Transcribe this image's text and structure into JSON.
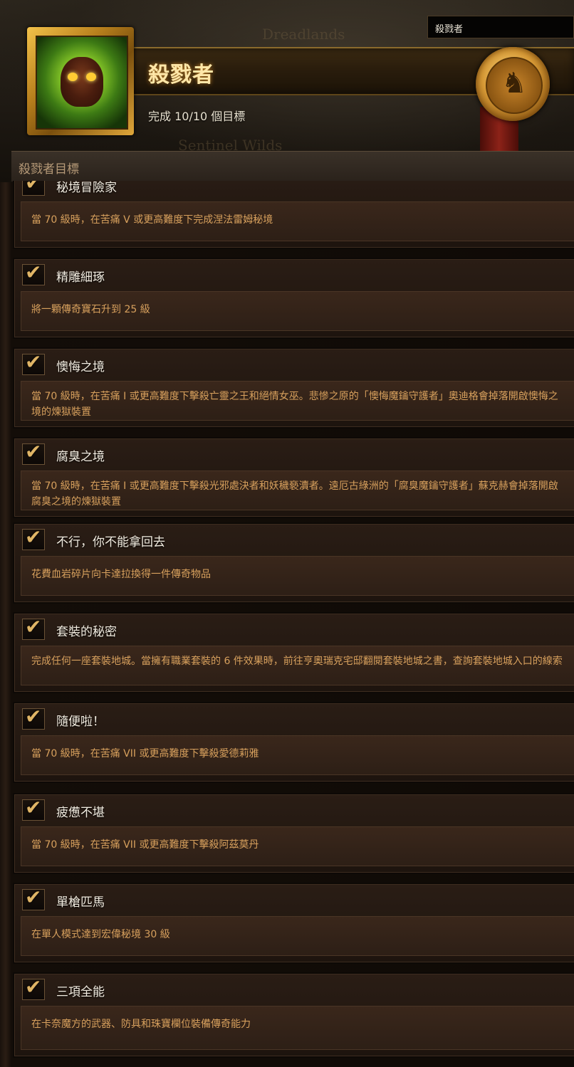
{
  "header": {
    "title": "殺戮者",
    "progress_text": "完成 10/10 個目標",
    "search_value": "殺戮者",
    "section_label": "殺戮者目標",
    "map_labels": [
      "Dreadlands",
      "Sentinel Wilds"
    ]
  },
  "icons": {
    "achievement": "skull-achievement-icon",
    "medal": "wolf-crest-medal-icon",
    "check": "checkmark-icon"
  },
  "colors": {
    "title_glow": "#c8872a",
    "description_text": "#d7a05d",
    "item_title_text": "#f2ece0"
  },
  "objectives": [
    {
      "title": "秘境冒險家",
      "completed": true,
      "description": "當 70 級時，在苦痛 V 或更高難度下完成涅法雷姆秘境"
    },
    {
      "title": "精雕細琢",
      "completed": true,
      "description": "將一顆傳奇寶石升到 25 級"
    },
    {
      "title": "懊悔之境",
      "completed": true,
      "description": "當 70 級時，在苦痛 I 或更高難度下擊殺亡靈之王和絕情女巫。悲慘之原的「懊悔魔鑰守護者」奧迪格會掉落開啟懊悔之境的煉獄裝置"
    },
    {
      "title": "腐臭之境",
      "completed": true,
      "description": "當 70 級時，在苦痛 I 或更高難度下擊殺光邪處決者和妖穢褻瀆者。遠厄古綠洲的「腐臭魔鑰守護者」蘇克赫會掉落開啟腐臭之境的煉獄裝置"
    },
    {
      "title": "不行，你不能拿回去",
      "completed": true,
      "description": "花費血岩碎片向卡達拉換得一件傳奇物品"
    },
    {
      "title": "套裝的秘密",
      "completed": true,
      "description": "完成任何一座套裝地城。當擁有職業套裝的 6 件效果時，前往亨奧瑞克宅邸翻閱套裝地城之書，查詢套裝地城入口的線索"
    },
    {
      "title": "隨便啦！",
      "completed": true,
      "description": "當 70 級時，在苦痛 VII 或更高難度下擊殺愛德莉雅"
    },
    {
      "title": "疲憊不堪",
      "completed": true,
      "description": "當 70 級時，在苦痛 VII 或更高難度下擊殺阿茲莫丹"
    },
    {
      "title": "單槍匹馬",
      "completed": true,
      "description": "在單人模式達到宏偉秘境 30 級"
    },
    {
      "title": "三項全能",
      "completed": true,
      "description": "在卡奈魔方的武器、防具和珠寶欄位裝備傳奇能力"
    }
  ]
}
